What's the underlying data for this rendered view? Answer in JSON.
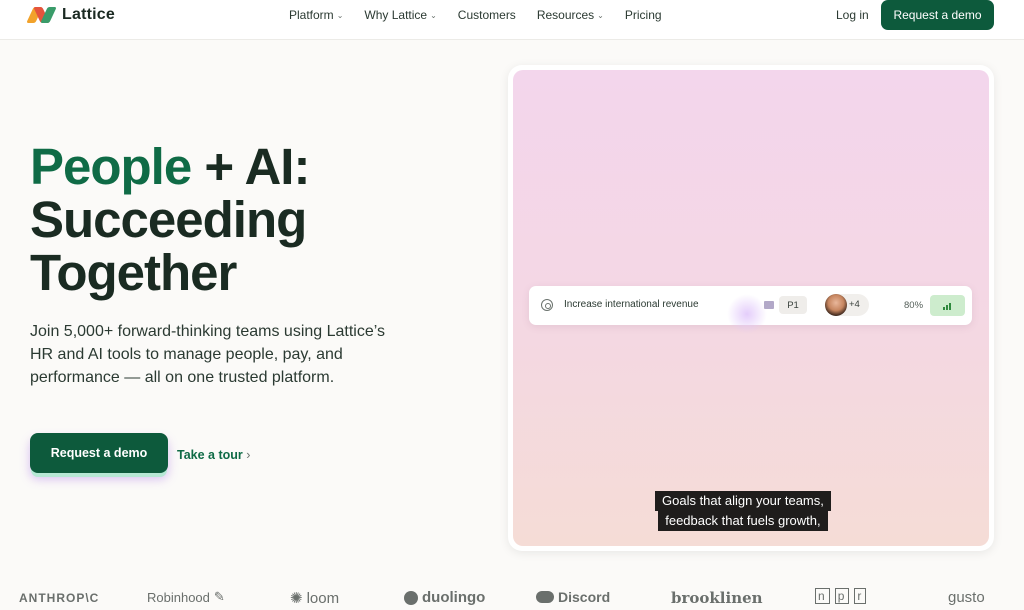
{
  "header": {
    "brand": "Lattice",
    "nav": [
      {
        "label": "Platform",
        "dropdown": true
      },
      {
        "label": "Why Lattice",
        "dropdown": true
      },
      {
        "label": "Customers",
        "dropdown": false
      },
      {
        "label": "Resources",
        "dropdown": true
      },
      {
        "label": "Pricing",
        "dropdown": false
      }
    ],
    "login": "Log in",
    "demo_button": "Request a demo"
  },
  "hero": {
    "title_green": "People",
    "title_rest_line1": " + AI:",
    "title_line2": "Succeeding",
    "title_line3": "Together",
    "subtitle": "Join 5,000+ forward-thinking teams using Lattice’s HR and AI tools to manage people, pay, and performance — all on one trusted platform.",
    "cta": "Request a demo",
    "tour": "Take a tour",
    "tour_arrow": "›"
  },
  "showcase": {
    "goal_label": "Increase international revenue",
    "priority": "P1",
    "avatar_extra": "+4",
    "progress_percent": "80%",
    "caption_line1": "Goals that align your teams,",
    "caption_line2": "feedback that fuels growth,"
  },
  "logos": {
    "anthropic": "ANTHROP\\C",
    "robinhood": "Robinhood",
    "loom": "loom",
    "duolingo": "duolingo",
    "discord": "Discord",
    "brooklinen": "brooklinen",
    "npr": [
      "n",
      "p",
      "r"
    ],
    "gusto": "gusto"
  },
  "colors": {
    "brand_green": "#0d5a3c",
    "title_green": "#0f6b46",
    "background": "#fbfaf8"
  }
}
